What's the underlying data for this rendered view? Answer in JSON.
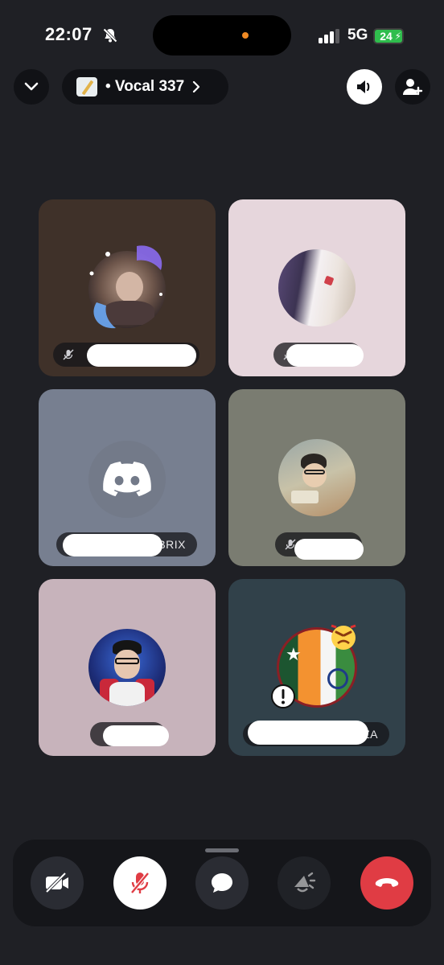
{
  "status_bar": {
    "time": "22:07",
    "network": "5G",
    "battery_level": "24",
    "icons": [
      "bell-slash-icon",
      "cellular-signal-icon",
      "battery-charging-icon"
    ]
  },
  "header": {
    "channel_name": "• Vocal 337",
    "icons": [
      "chevron-down-icon",
      "memo-emoji-icon",
      "chevron-right-icon",
      "speaker-icon",
      "add-person-icon"
    ]
  },
  "participants": [
    {
      "id": 1,
      "name_suffix": "",
      "muted": true,
      "tile_color": "#3f3129"
    },
    {
      "id": 2,
      "name_suffix": "",
      "muted": true,
      "tile_color": "#e6d6dc"
    },
    {
      "id": 3,
      "name_suffix": "BRIX",
      "muted": false,
      "tile_color": "#777f90"
    },
    {
      "id": 4,
      "name_suffix": "",
      "muted": true,
      "tile_color": "#7a7c71"
    },
    {
      "id": 5,
      "name_suffix": "",
      "muted": false,
      "tile_color": "#c7b3bb"
    },
    {
      "id": 6,
      "name_suffix": "AZA",
      "muted": false,
      "tile_color": "#31414a"
    }
  ],
  "controls": {
    "icons": [
      "camera-off-icon",
      "microphone-off-icon",
      "chat-bubble-icon",
      "soundboard-icon",
      "hang-up-icon"
    ],
    "colors": {
      "hang_up": "#e03c44",
      "mic_active_bg": "#ffffff",
      "mic_icon": "#e03c44",
      "default_bg": "#2a2c33"
    }
  }
}
